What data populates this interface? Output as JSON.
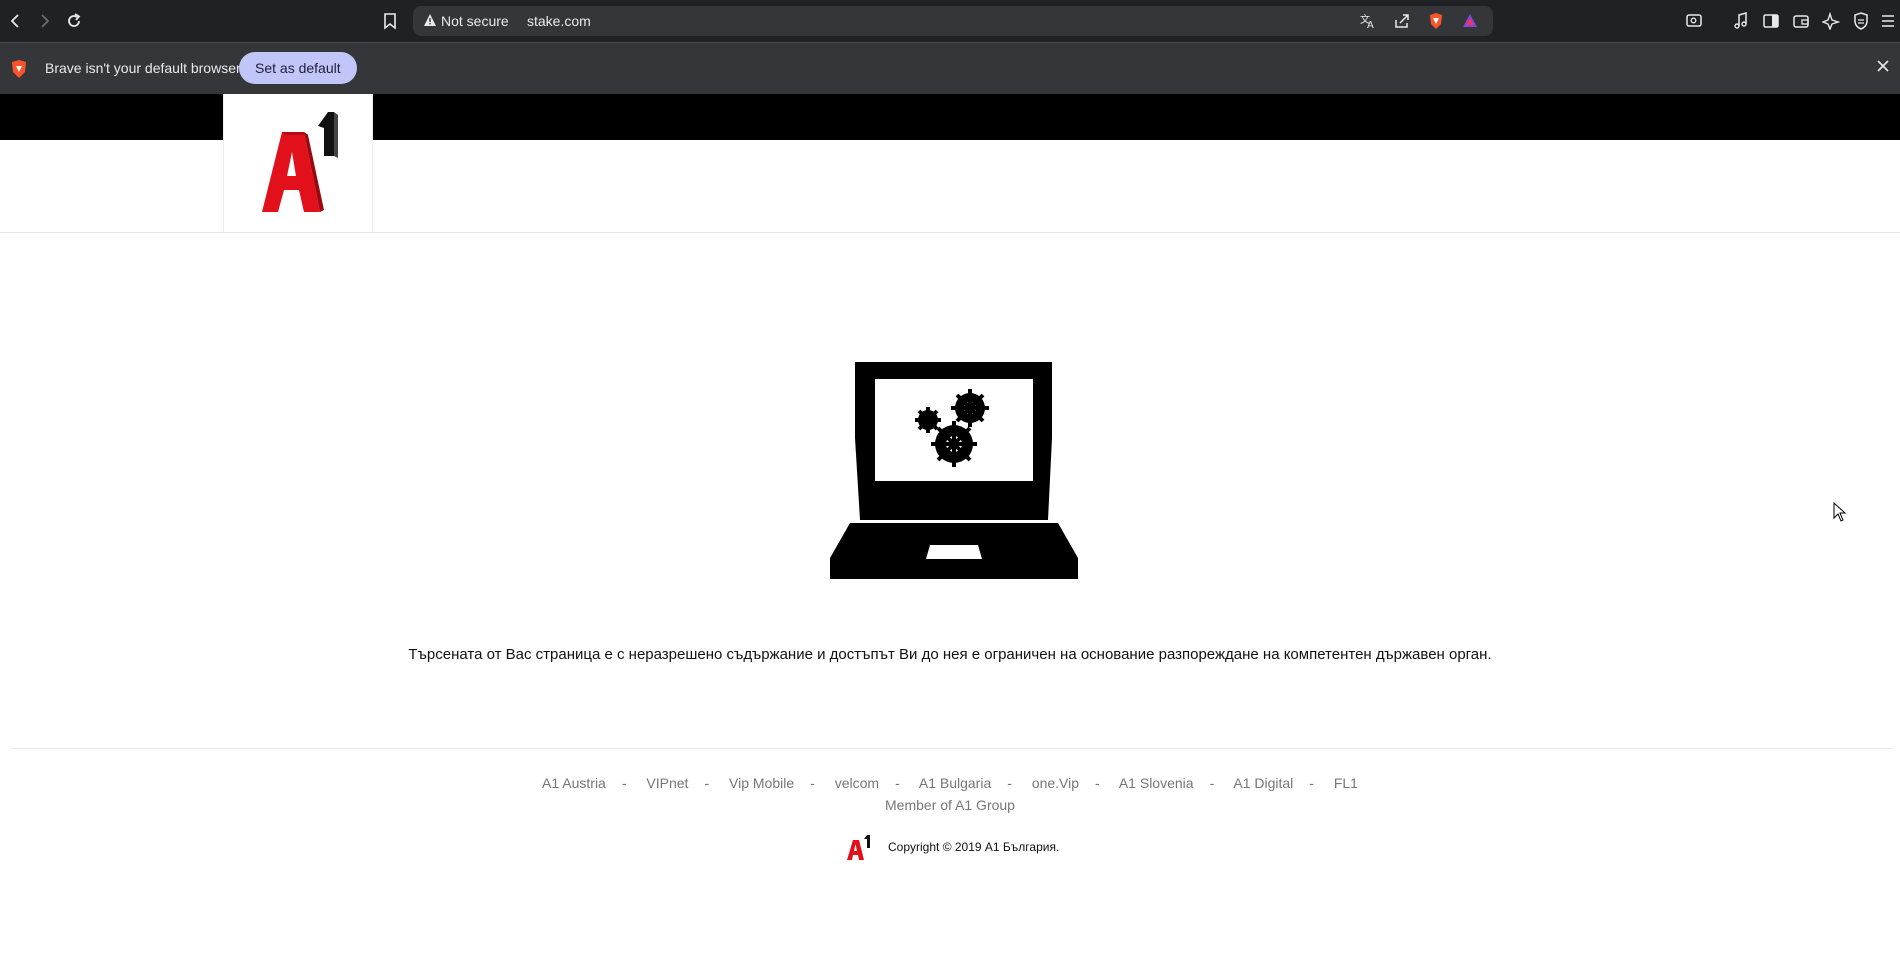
{
  "browser": {
    "security_label": "Not secure",
    "url": "stake.com",
    "infobar": {
      "message": "Brave isn't your default browser",
      "action_label": "Set as default"
    },
    "icons": [
      "back-icon",
      "forward-icon",
      "reload-icon",
      "bookmark-icon",
      "warning-icon",
      "translate-icon",
      "share-icon",
      "brave-shields-icon",
      "brave-rewards-icon",
      "reader-mode-icon",
      "media-icon",
      "sidebar-icon",
      "wallet-icon",
      "leo-ai-icon",
      "vpn-icon",
      "menu-icon",
      "close-icon"
    ]
  },
  "page": {
    "logo_alt": "A1",
    "blocked_message": "Търсената от Вас страница е с неразрешено съдържание и достъпът Ви до нея е ограничен на основание разпореждане на компетентен държавен орган.",
    "footer": {
      "links": [
        "A1 Austria",
        "VIPnet",
        "Vip Mobile",
        "velcom",
        "A1 Bulgaria",
        "one.Vip",
        "A1 Slovenia",
        "A1 Digital",
        "FL1"
      ],
      "separator": "-",
      "member_text": "Member of A1 Group",
      "copyright": "Copyright © 2019 А1 България."
    }
  },
  "colors": {
    "toolbar_bg": "#202124",
    "infobar_bg": "#35363a",
    "infobar_button": "#c2c5f8",
    "a1_red": "#e2101a",
    "page_topbar": "#000000"
  }
}
